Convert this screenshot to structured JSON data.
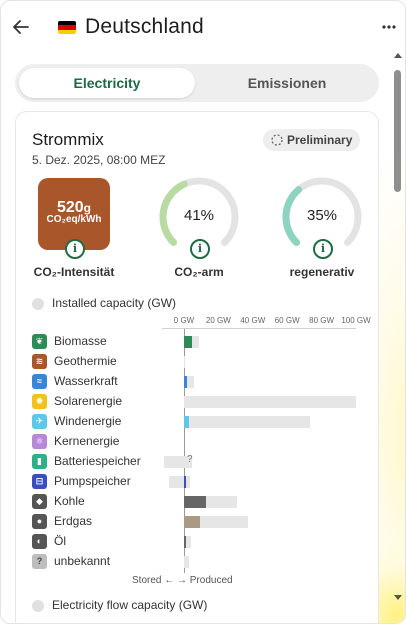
{
  "header": {
    "title": "Deutschland",
    "back_icon": "arrow-left-icon",
    "more_icon": "more-horizontal-icon",
    "flag": [
      "#000000",
      "#dd0000",
      "#ffce00"
    ]
  },
  "tabs": [
    {
      "label": "Electricity",
      "active": true
    },
    {
      "label": "Emissionen",
      "active": false
    }
  ],
  "card": {
    "title": "Strommix",
    "date": "5. Dez. 2025, 08:00 MEZ",
    "badge": "Preliminary",
    "metrics": {
      "carbon_intensity": {
        "value": "520",
        "value_unit": "g",
        "unit": "CO₂eq/kWh",
        "label": "CO₂-Intensität",
        "color": "#a9562b"
      },
      "low_carbon": {
        "value": "41%",
        "fraction": 0.41,
        "label": "CO₂-arm",
        "color": "#b7dba2"
      },
      "renewable": {
        "value": "35%",
        "fraction": 0.35,
        "label": "regenerativ",
        "color": "#8dd3c1"
      }
    },
    "installed_capacity_label": "Installed capacity (GW)",
    "flow_capacity_label": "Electricity flow capacity (GW)",
    "axis_ticks": [
      "0 GW",
      "20 GW",
      "40 GW",
      "60 GW",
      "80 GW",
      "100 GW"
    ],
    "stored_produced": "Stored ← → Produced",
    "sources": [
      {
        "name": "Biomasse",
        "icon": "leaf-icon",
        "icon_color": "#2e8b57",
        "installed": 9,
        "produced": 4.5,
        "stored": 0,
        "color": "#2e8b57"
      },
      {
        "name": "Geothermie",
        "icon": "heat-icon",
        "icon_color": "#a9562b",
        "installed": 0.2,
        "produced": 0,
        "stored": 0,
        "color": "#a9562b"
      },
      {
        "name": "Wasserkraft",
        "icon": "waves-icon",
        "icon_color": "#3a86d6",
        "installed": 6,
        "produced": 1.5,
        "stored": 0,
        "color": "#3a86d6"
      },
      {
        "name": "Solarenergie",
        "icon": "sun-icon",
        "icon_color": "#f3c11b",
        "installed": 100,
        "produced": 0,
        "stored": 0,
        "color": "#f3c11b"
      },
      {
        "name": "Windenergie",
        "icon": "wind-icon",
        "icon_color": "#5ec8e8",
        "installed": 73,
        "produced": 3,
        "stored": 0,
        "color": "#5ec8e8"
      },
      {
        "name": "Kernenergie",
        "icon": "atom-icon",
        "icon_color": "#b588d8",
        "installed": 0,
        "produced": 0,
        "stored": 0,
        "color": "#b588d8"
      },
      {
        "name": "Batteriespeicher",
        "icon": "battery-icon",
        "icon_color": "#2fae8a",
        "installed": 13,
        "produced": 0,
        "stored": 13,
        "color": "#2fae8a",
        "unknown": "?"
      },
      {
        "name": "Pumpspeicher",
        "icon": "pump-icon",
        "icon_color": "#3b4fc4",
        "installed": 10,
        "produced": 0.6,
        "stored": 10,
        "color": "#3b4fc4"
      },
      {
        "name": "Kohle",
        "icon": "coal-icon",
        "icon_color": "#555555",
        "installed": 31,
        "produced": 13,
        "stored": 0,
        "color": "#666666"
      },
      {
        "name": "Erdgas",
        "icon": "gas-icon",
        "icon_color": "#555555",
        "installed": 37,
        "produced": 9.5,
        "stored": 0,
        "color": "#a89a85"
      },
      {
        "name": "Öl",
        "icon": "oil-icon",
        "icon_color": "#555555",
        "installed": 4,
        "produced": 0.5,
        "stored": 0,
        "color": "#666666"
      },
      {
        "name": "unbekannt",
        "icon": "question-icon",
        "icon_color": "#888888",
        "installed": 3,
        "produced": 0,
        "stored": 0,
        "color": "#999999"
      }
    ]
  }
}
